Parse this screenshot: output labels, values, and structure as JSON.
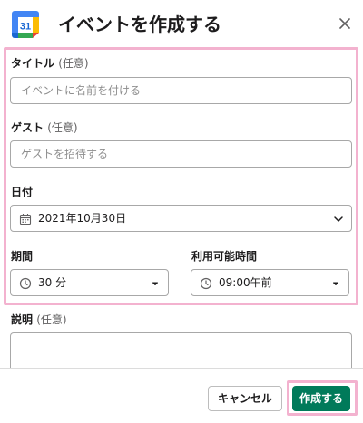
{
  "dialog": {
    "title": "イベントを作成する",
    "calendar_icon_day": "31"
  },
  "form": {
    "title_field": {
      "label": "タイトル",
      "optional": "(任意)",
      "placeholder": "イベントに名前を付ける"
    },
    "guest_field": {
      "label": "ゲスト",
      "optional": "(任意)",
      "placeholder": "ゲストを招待する"
    },
    "date_field": {
      "label": "日付",
      "value": "2021年10月30日"
    },
    "duration_field": {
      "label": "期間",
      "value": "30 分"
    },
    "available_field": {
      "label": "利用可能時間",
      "value": "09:00午前"
    },
    "description_field": {
      "label": "説明",
      "optional": "(任意)"
    }
  },
  "footer": {
    "cancel_label": "キャンセル",
    "create_label": "作成する"
  },
  "colors": {
    "highlight": "#f3b2cf",
    "primary": "#007a5a"
  },
  "icons": {
    "app": "google-calendar-icon",
    "close": "close-icon",
    "date": "calendar-icon",
    "duration": "clock-icon",
    "available": "clock-icon",
    "chevron": "chevron-down-icon"
  }
}
